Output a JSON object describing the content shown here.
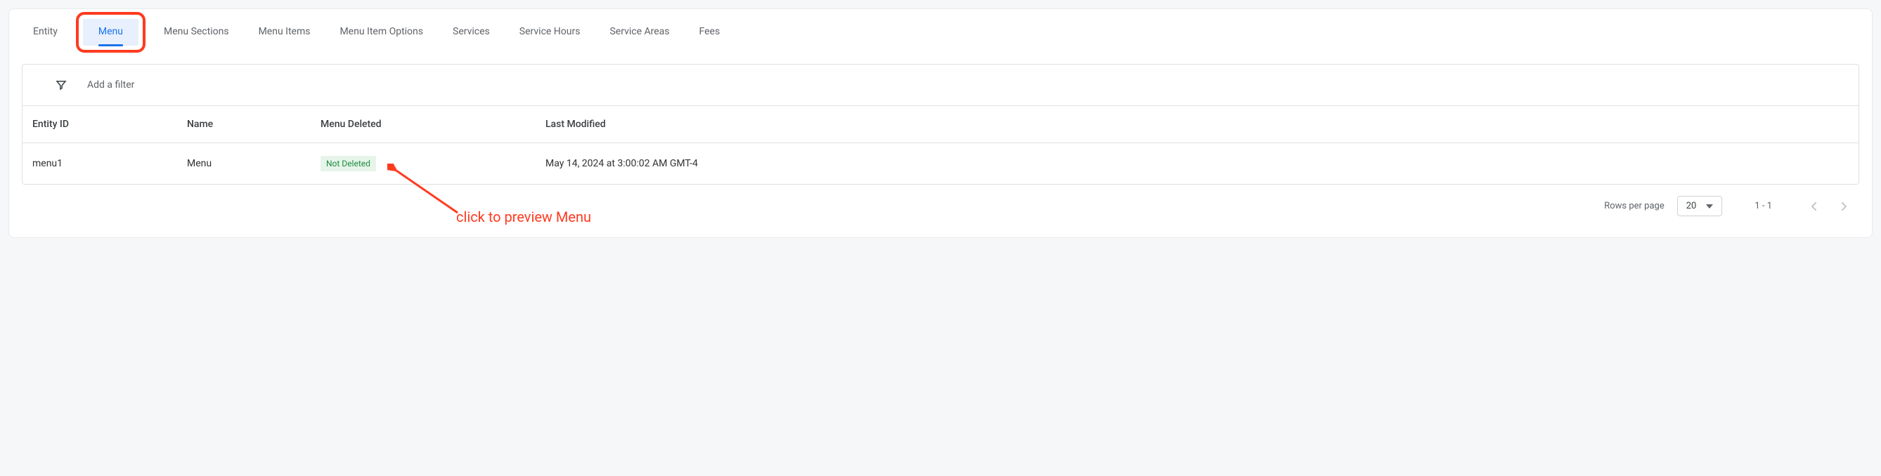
{
  "tabs": [
    {
      "label": "Entity"
    },
    {
      "label": "Menu",
      "active": true
    },
    {
      "label": "Menu Sections"
    },
    {
      "label": "Menu Items"
    },
    {
      "label": "Menu Item Options"
    },
    {
      "label": "Services"
    },
    {
      "label": "Service Hours"
    },
    {
      "label": "Service Areas"
    },
    {
      "label": "Fees"
    }
  ],
  "filter": {
    "placeholder": "Add a filter"
  },
  "table": {
    "headers": {
      "entity_id": "Entity ID",
      "name": "Name",
      "menu_deleted": "Menu Deleted",
      "last_modified": "Last Modified"
    },
    "rows": [
      {
        "entity_id": "menu1",
        "name": "Menu",
        "menu_deleted": "Not Deleted",
        "last_modified": "May 14, 2024 at 3:00:02 AM GMT-4"
      }
    ]
  },
  "pagination": {
    "label": "Rows per page",
    "per_page": "20",
    "range": "1 - 1"
  },
  "annotation": {
    "text": "click to preview Menu"
  }
}
